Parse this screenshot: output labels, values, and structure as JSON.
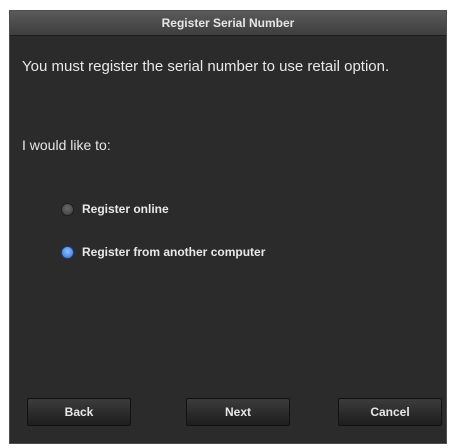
{
  "window": {
    "title": "Register Serial Number"
  },
  "content": {
    "message": "You must register the serial number to use retail option.",
    "prompt": "I would like to:",
    "options": [
      {
        "label": "Register online",
        "selected": false
      },
      {
        "label": "Register from another computer",
        "selected": true
      }
    ]
  },
  "buttons": {
    "back": "Back",
    "next": "Next",
    "cancel": "Cancel"
  },
  "colors": {
    "background": "#2b2b2b",
    "text": "#e8e8e8",
    "selected_radio": "#2f6fd6"
  }
}
